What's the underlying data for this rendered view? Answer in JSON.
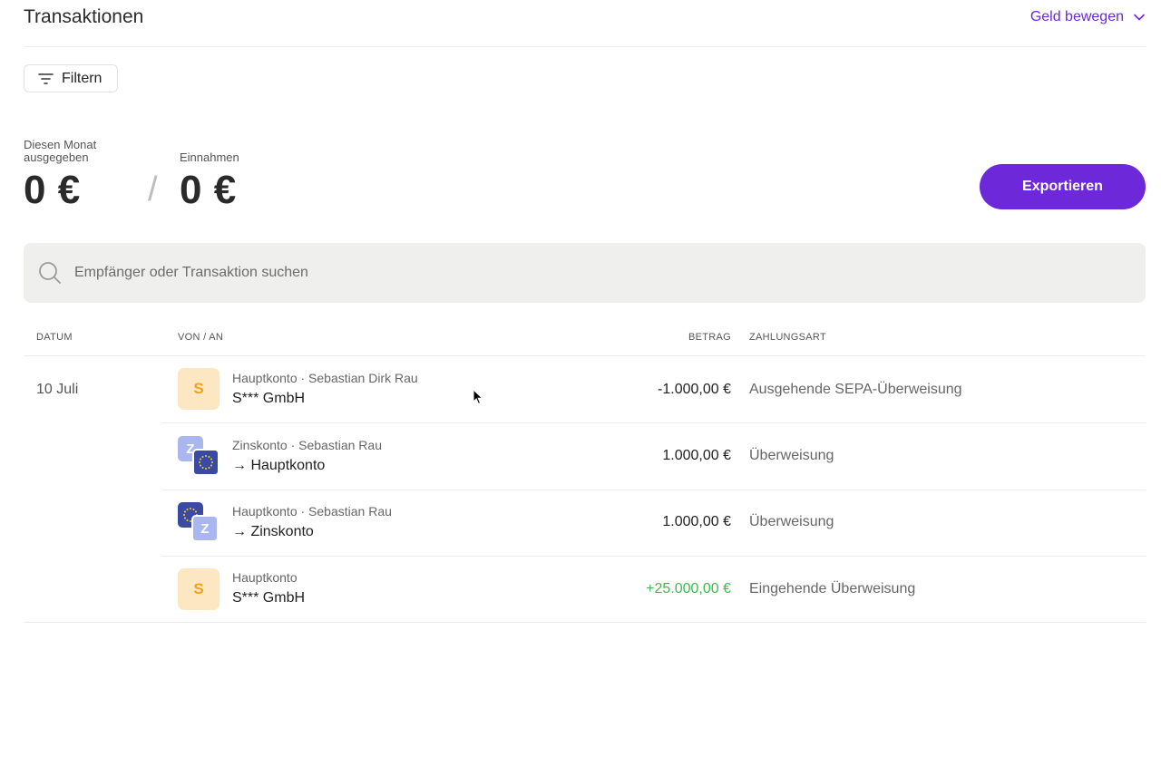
{
  "header": {
    "title": "Transaktionen",
    "move_money_label": "Geld bewegen"
  },
  "filter": {
    "label": "Filtern"
  },
  "stats": {
    "spent_label_line1": "Diesen Monat",
    "spent_label_line2": "ausgegeben",
    "spent_value": "0 €",
    "income_label": "Einnahmen",
    "income_value": "0 €",
    "separator": "/"
  },
  "export": {
    "label": "Exportieren"
  },
  "search": {
    "placeholder": "Empfänger oder Transaktion suchen",
    "value": ""
  },
  "table": {
    "headers": {
      "date": "DATUM",
      "party": "VON / AN",
      "amount": "BETRAG",
      "method": "ZAHLUNGSART"
    },
    "date_group": "10 Juli",
    "rows": [
      {
        "icon": "company-s-avatar",
        "avatar_letter": "S",
        "sub": "Hauptkonto · Sebastian Dirk Rau",
        "main": "S*** GmbH",
        "amount": "-1.000,00 €",
        "method": "Ausgehende SEPA-Überweisung"
      },
      {
        "icon": "zinskonto-to-hauptkonto-icon",
        "avatar_letter": "Z",
        "sub": "Zinskonto · Sebastian Rau",
        "main": "→ Hauptkonto",
        "amount": "1.000,00 €",
        "method": "Überweisung"
      },
      {
        "icon": "hauptkonto-to-zinskonto-icon",
        "avatar_letter": "Z",
        "sub": "Hauptkonto · Sebastian Rau",
        "main": "→ Zinskonto",
        "amount": "1.000,00 €",
        "method": "Überweisung"
      },
      {
        "icon": "company-s-avatar",
        "avatar_letter": "S",
        "sub": "Hauptkonto",
        "main": "S*** GmbH",
        "amount": "+25.000,00 €",
        "method": "Eingehende Überweisung"
      }
    ]
  },
  "colors": {
    "accent": "#6d28d9",
    "positive": "#3dbb4f",
    "avatar_bg": "#fde7c3",
    "avatar_fg": "#f0a21a"
  }
}
